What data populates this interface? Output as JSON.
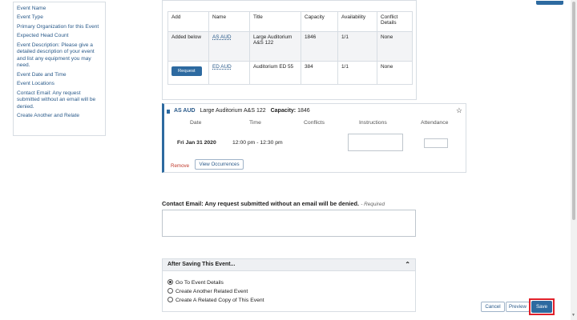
{
  "sidebar": {
    "items": [
      "Event Name",
      "Event Type",
      "Primary Organization for this Event",
      "Expected Head Count",
      "Event Description: Please give a detailed description of your event and list any equipment you may need.",
      "Event Date and Time",
      "Event Locations",
      "Contact Email: Any request submitted without an email will be denied.",
      "Create Another and Relate"
    ]
  },
  "locations_table": {
    "headers": [
      "Add",
      "Name",
      "Title",
      "Capacity",
      "Availability",
      "Conflict Details"
    ],
    "rows": [
      {
        "add": "Added below",
        "name": "AS AUD",
        "title": "Large Auditorium A&S 122",
        "capacity": "1846",
        "availability": "1/1",
        "conflict": "None"
      },
      {
        "add": "Request",
        "name": "ED AUD",
        "title": "Auditorium ED 55",
        "capacity": "384",
        "availability": "1/1",
        "conflict": "None"
      }
    ]
  },
  "selected_location": {
    "code": "AS AUD",
    "title": "Large Auditorium A&S 122",
    "capacity_label": "Capacity:",
    "capacity": "1846",
    "headers": {
      "date": "Date",
      "time": "Time",
      "conflicts": "Conflicts",
      "instructions": "Instructions",
      "attendance": "Attendance"
    },
    "occurrence": {
      "date": "Fri Jan 31 2020",
      "time": "12:00 pm - 12:30 pm"
    },
    "remove_label": "Remove",
    "view_label": "View Occurrences"
  },
  "contact": {
    "label": "Contact Email: Any request submitted without an email will be denied.",
    "required": "- Required"
  },
  "after_saving": {
    "title": "After Saving This Event...",
    "options": [
      "Go To Event Details",
      "Create Another Related Event",
      "Create A Related Copy of This Event"
    ],
    "selected": "Go To Event Details"
  },
  "footer": {
    "cancel": "Cancel",
    "preview": "Preview",
    "save": "Save"
  },
  "colors": {
    "accent": "#2d6aa0",
    "highlight": "#e0202a"
  }
}
